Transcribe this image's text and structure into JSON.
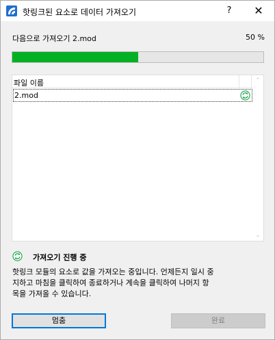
{
  "window": {
    "title": "핫링크된 요소로 데이터 가져오기",
    "help_label": "?",
    "close_label": "✕"
  },
  "status": {
    "current_text": "다음으로 가져오기 2.mod",
    "percent_text": "50 %",
    "progress_fraction": 0.5
  },
  "list": {
    "header": {
      "name": "파일 이름"
    },
    "rows": [
      {
        "name": "2.mod",
        "icon": "sync-icon"
      }
    ],
    "scroll_up": "⌃",
    "scroll_down": "⌄"
  },
  "progress_section": {
    "icon": "sync-icon",
    "label": "가져오기 진행 중",
    "description": "핫링크 모듈의 요소로 값을 가져오는 중입니다. 언제든지 일시 중\n지하고 마침을 클릭하여 종료하거나 계속을 클릭하여 나머지 항\n목을 가져올 수 있습니다."
  },
  "buttons": {
    "stop_label": "멈춤",
    "done_label": "완료"
  },
  "colors": {
    "progress": "#06b025",
    "focus_border": "#0078d7",
    "sync_icon": "#17a34a",
    "app_icon": "#1f6fd0"
  }
}
